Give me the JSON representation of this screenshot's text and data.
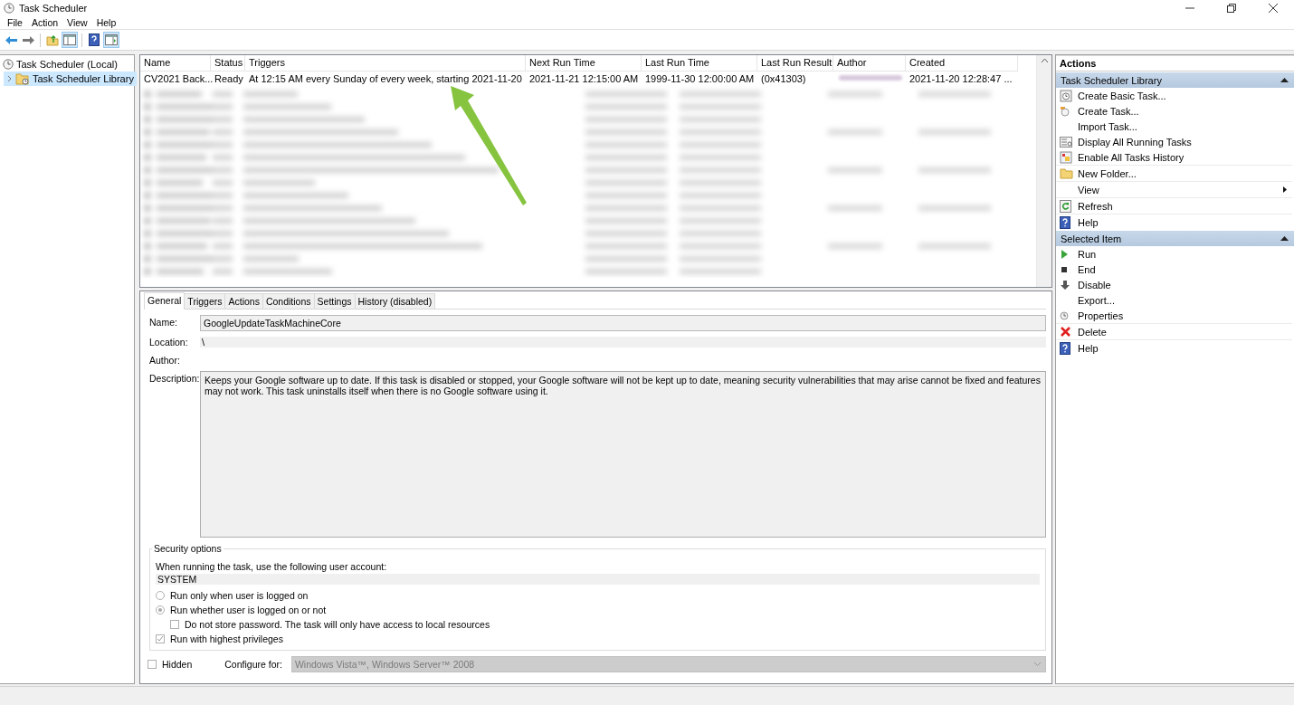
{
  "window": {
    "title": "Task Scheduler"
  },
  "menu": [
    "File",
    "Action",
    "View",
    "Help"
  ],
  "toolbar": [
    {
      "pressed": false
    },
    {
      "pressed": false
    },
    {
      "pressed": false
    },
    {
      "pressed": true
    },
    {
      "pressed": false
    },
    {
      "pressed": true
    }
  ],
  "tree": [
    {
      "label": "Task Scheduler (Local)",
      "selected": false,
      "children": [
        {
          "label": "Task Scheduler Library",
          "selected": true,
          "expanded": false
        }
      ]
    }
  ],
  "task_list": {
    "columns": [
      "Name",
      "Status",
      "Triggers",
      "Next Run Time",
      "Last Run Time",
      "Last Run Result",
      "Author",
      "Created"
    ],
    "rows": [
      {
        "cells": [
          "CV2021 Back...",
          "Ready",
          "At 12:15 AM every Sunday of every week, starting 2021-11-20",
          "2021-11-21 12:15:00 AM",
          "1999-11-30 12:00:00 AM",
          "(0x41303)",
          "",
          "2021-11-20 12:28:47 ..."
        ]
      }
    ]
  },
  "details": {
    "tabs": [
      {
        "label": "General",
        "selected": true
      },
      {
        "label": "Triggers",
        "selected": false
      },
      {
        "label": "Actions",
        "selected": false
      },
      {
        "label": "Conditions",
        "selected": false
      },
      {
        "label": "Settings",
        "selected": false
      },
      {
        "label": "History (disabled)",
        "selected": false
      }
    ],
    "fields": [
      {
        "label": "Name:",
        "kind": "box",
        "value": "GoogleUpdateTaskMachineCore"
      },
      {
        "label": "Location:",
        "kind": "line",
        "value": "\\"
      },
      {
        "label": "Author:",
        "kind": "plain"
      },
      {
        "label": "Description:",
        "kind": "area",
        "value": "Keeps your Google software up to date. If this task is disabled or stopped, your Google software will not be kept up to date, meaning security vulnerabilities that may arise cannot be fixed and features may not work. This task uninstalls itself when there is no Google software using it."
      }
    ],
    "security": {
      "title": "Security options",
      "account_label": "When running the task, use the following user account:",
      "account": "SYSTEM",
      "options": [
        {
          "kind": "radio",
          "label": "Run only when user is logged on",
          "selected": false
        },
        {
          "kind": "radio",
          "label": "Run whether user is logged on or not",
          "selected": true,
          "children": [
            {
              "kind": "checkbox",
              "label": "Do not store password.  The task will only have access to local resources",
              "checked": false
            }
          ]
        },
        {
          "kind": "checkbox",
          "label": "Run with highest privileges",
          "checked": true
        }
      ]
    },
    "hidden": {
      "label": "Hidden",
      "checked": false
    },
    "configure": {
      "label": "Configure for:",
      "value": "Windows Vista™, Windows Server™ 2008"
    }
  },
  "actions": {
    "title": "Actions",
    "sections": [
      {
        "title": "Task Scheduler Library",
        "expanded": true,
        "items": [
          {
            "label": "Create Basic Task...",
            "submenu": false
          },
          {
            "label": "Create Task...",
            "submenu": false
          },
          {
            "label": "Import Task...",
            "submenu": false
          },
          {
            "label": "Display All Running Tasks",
            "submenu": false
          },
          {
            "label": "Enable All Tasks History",
            "submenu": false
          },
          {
            "label": "New Folder...",
            "submenu": false
          },
          {
            "label": "View",
            "submenu": true
          },
          {
            "label": "Refresh",
            "submenu": false
          },
          {
            "label": "Help",
            "submenu": false
          }
        ]
      },
      {
        "title": "Selected Item",
        "expanded": true,
        "items": [
          {
            "label": "Run",
            "submenu": false
          },
          {
            "label": "End",
            "submenu": false
          },
          {
            "label": "Disable",
            "submenu": false
          },
          {
            "label": "Export...",
            "submenu": false
          },
          {
            "label": "Properties",
            "submenu": false
          },
          {
            "label": "Delete",
            "submenu": false
          },
          {
            "label": "Help",
            "submenu": false
          }
        ]
      }
    ]
  }
}
